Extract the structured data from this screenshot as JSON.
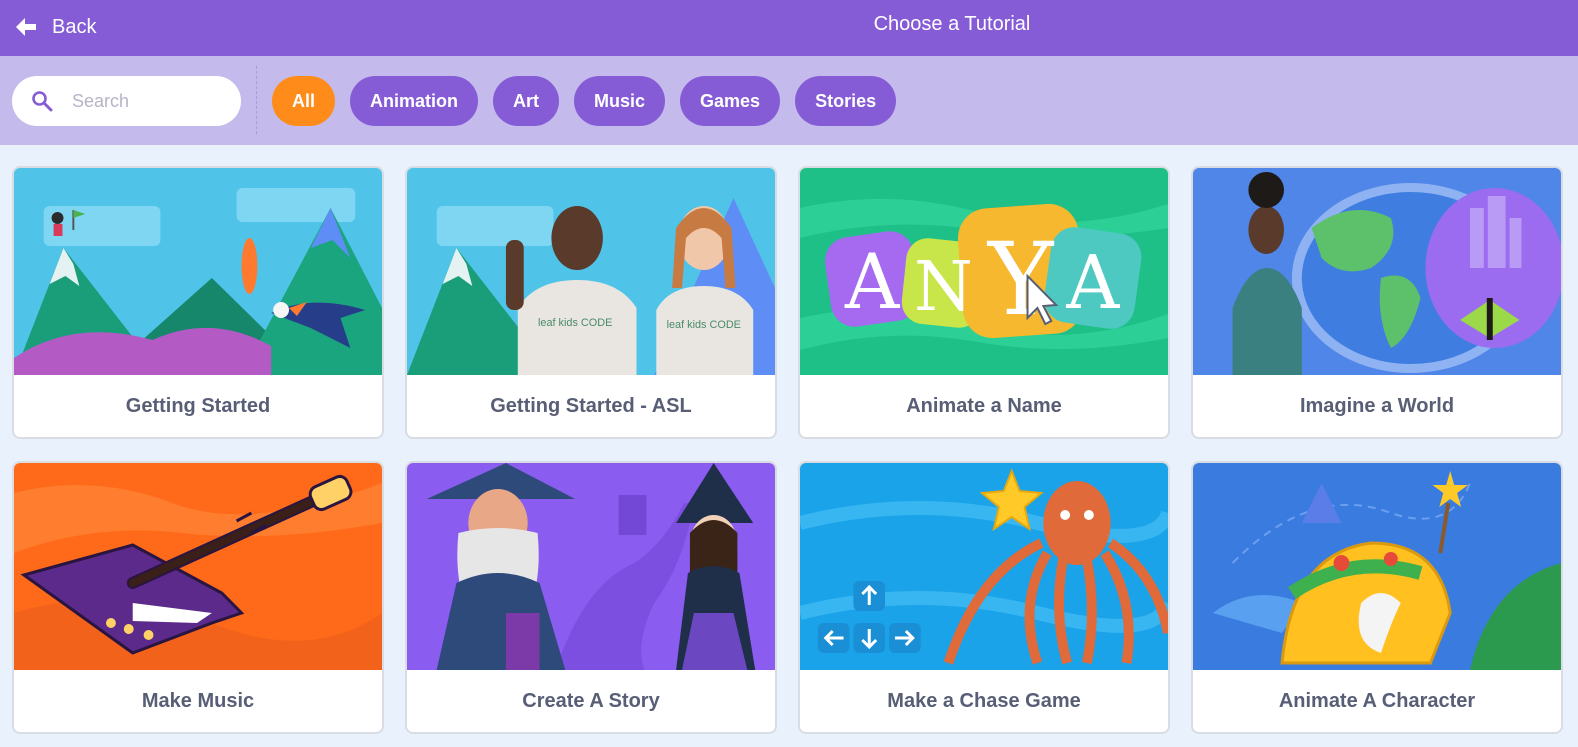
{
  "header": {
    "back_label": "Back",
    "title": "Choose a Tutorial"
  },
  "search": {
    "placeholder": "Search"
  },
  "filters": [
    "All",
    "Animation",
    "Art",
    "Music",
    "Games",
    "Stories"
  ],
  "active_filter": "All",
  "tutorials": [
    {
      "title": "Getting Started"
    },
    {
      "title": "Getting Started - ASL",
      "shirt_text": "leaf kids CODE"
    },
    {
      "title": "Animate a Name",
      "letters": [
        "A",
        "N",
        "Y",
        "A"
      ]
    },
    {
      "title": "Imagine a World"
    },
    {
      "title": "Make Music"
    },
    {
      "title": "Create A Story"
    },
    {
      "title": "Make a Chase Game"
    },
    {
      "title": "Animate A Character"
    }
  ],
  "colors": {
    "header": "#855cd6",
    "filterbar": "#c4bbec",
    "pill": "#855cd6",
    "pill_active": "#ff8c1a",
    "page_bg": "#e9f1fc",
    "card_text": "#575e75"
  }
}
